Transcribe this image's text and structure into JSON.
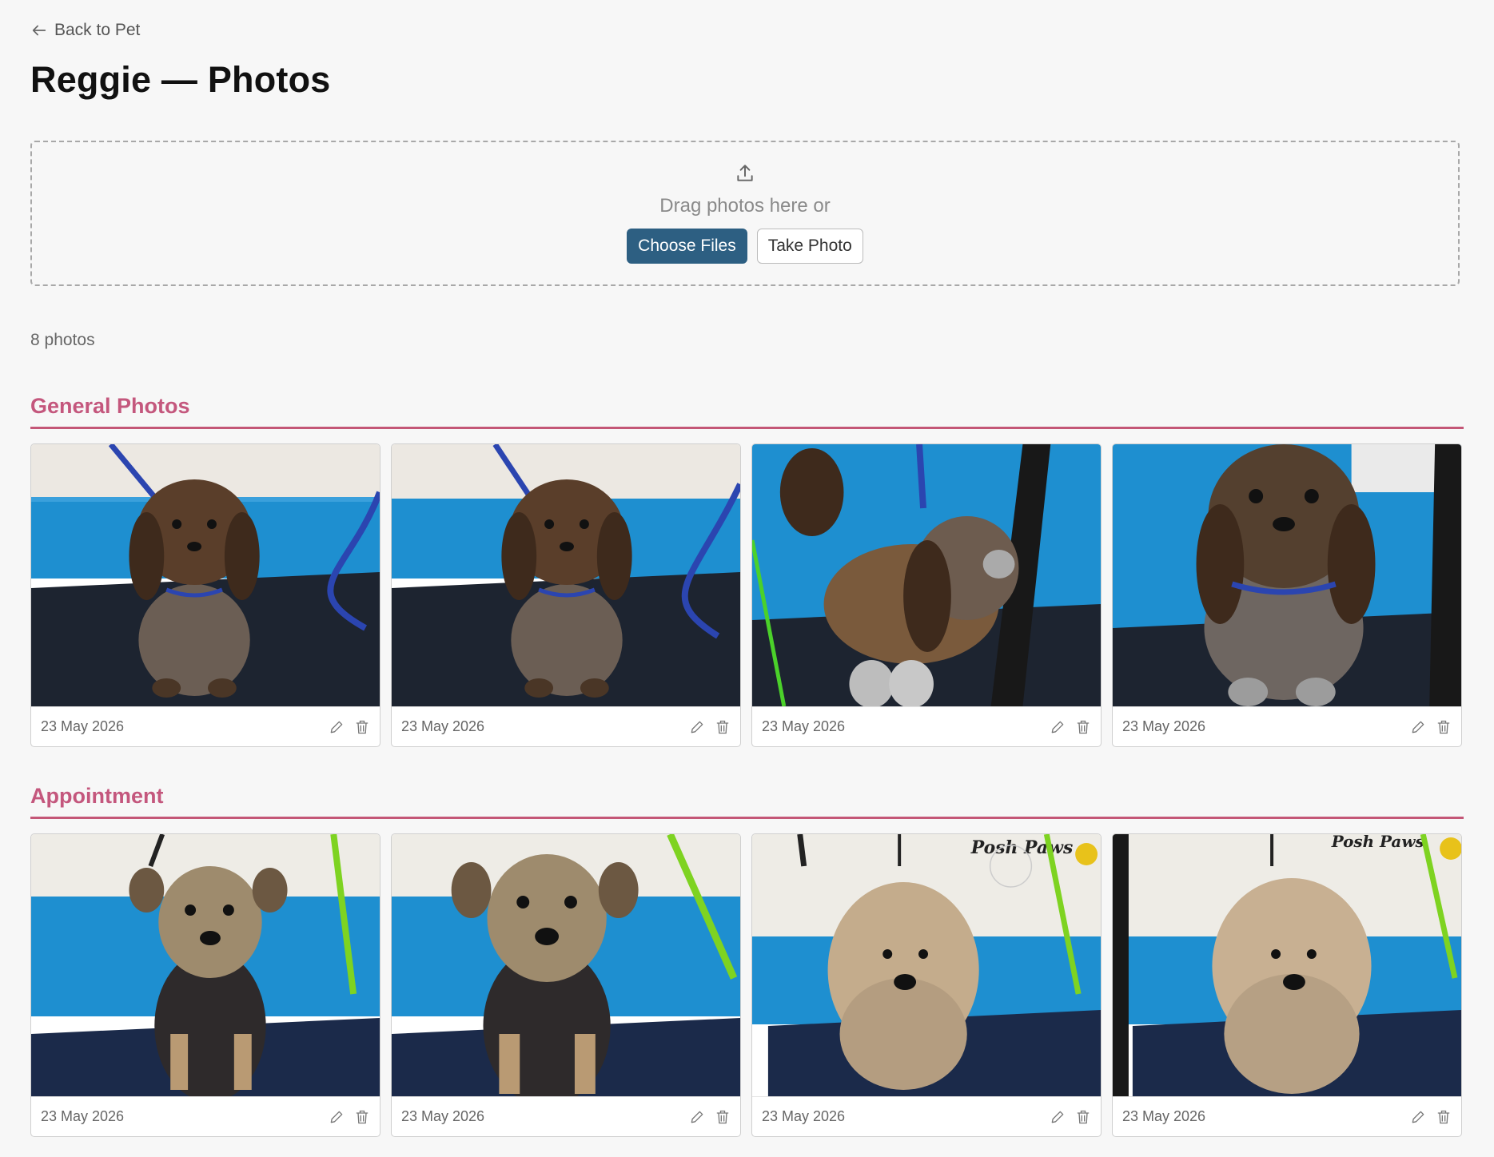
{
  "nav": {
    "back_label": "Back to Pet"
  },
  "page": {
    "title": "Reggie — Photos"
  },
  "upload": {
    "prompt": "Drag photos here or",
    "choose_files_label": "Choose Files",
    "take_photo_label": "Take Photo"
  },
  "photo_count": "8 photos",
  "sections": [
    {
      "title": "General Photos",
      "photos": [
        {
          "date": "23 May 2026"
        },
        {
          "date": "23 May 2026"
        },
        {
          "date": "23 May 2026"
        },
        {
          "date": "23 May 2026"
        }
      ]
    },
    {
      "title": "Appointment",
      "photos": [
        {
          "date": "23 May 2026"
        },
        {
          "date": "23 May 2026"
        },
        {
          "date": "23 May 2026"
        },
        {
          "date": "23 May 2026"
        }
      ]
    }
  ],
  "photo_signs": {
    "salon_name": "Posh Paws"
  },
  "colors": {
    "accent": "#c4577d",
    "primary_button": "#2d5f82",
    "wall_blue": "#1e8fd0",
    "table_dark": "#1d2430"
  }
}
